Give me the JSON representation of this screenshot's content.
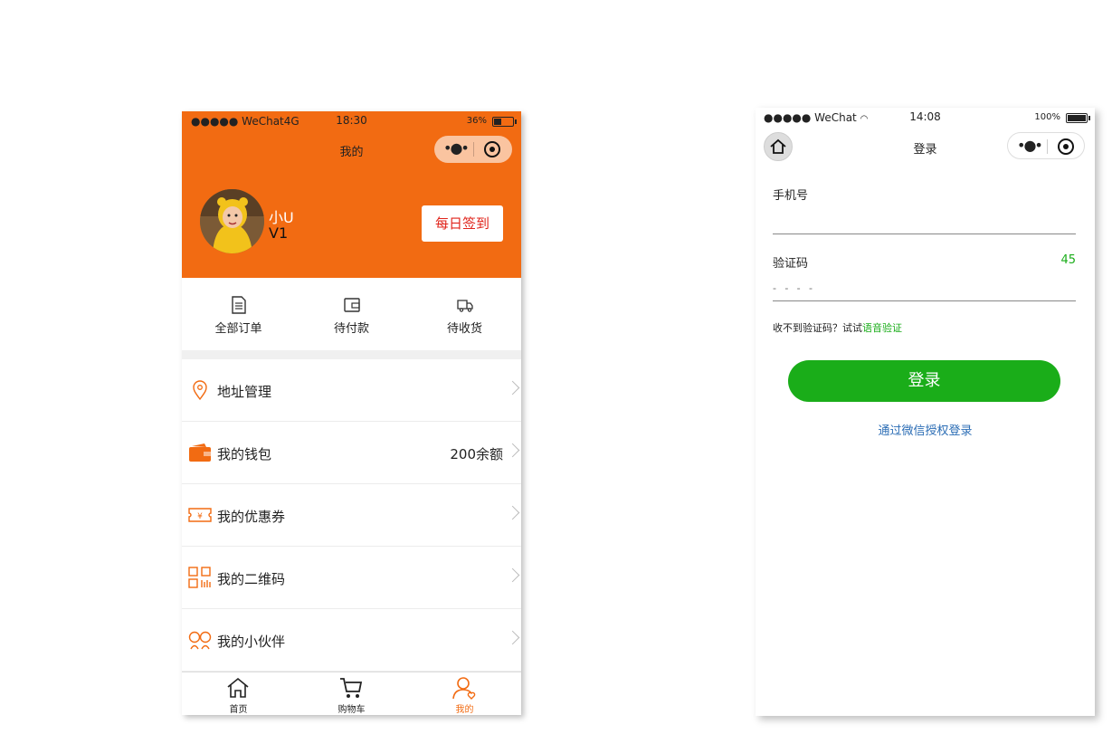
{
  "left_phone": {
    "status_bar": {
      "carrier": "●●●●● WeChat4G",
      "time": "18:30",
      "battery": "36%",
      "battery_level": 0.36
    },
    "nav": {
      "title": "我的"
    },
    "user": {
      "name": "小U",
      "level": "V1",
      "signin_label": "每日签到"
    },
    "orders": [
      {
        "label": "全部订单",
        "icon": "document-icon"
      },
      {
        "label": "待付款",
        "icon": "wallet-icon"
      },
      {
        "label": "待收货",
        "icon": "truck-icon"
      }
    ],
    "menu": [
      {
        "label": "地址管理",
        "value": "",
        "icon": "location-pin-icon"
      },
      {
        "label": "我的钱包",
        "value": "200余额",
        "icon": "wallet-icon"
      },
      {
        "label": "我的优惠券",
        "value": "",
        "icon": "coupon-icon"
      },
      {
        "label": "我的二维码",
        "value": "",
        "icon": "qrcode-icon"
      },
      {
        "label": "我的小伙伴",
        "value": "",
        "icon": "friends-icon"
      }
    ],
    "tabbar": [
      {
        "label": "首页",
        "icon": "home-icon"
      },
      {
        "label": "购物车",
        "icon": "cart-icon"
      },
      {
        "label": "我的",
        "icon": "user-icon"
      }
    ],
    "colors": {
      "accent": "#f26b12",
      "signin_text": "#e0241b"
    }
  },
  "right_phone": {
    "status_bar": {
      "carrier": "●●●●● WeChat",
      "time": "14:08",
      "battery": "100%",
      "battery_level": 1.0
    },
    "nav": {
      "title": "登录"
    },
    "form": {
      "phone_label": "手机号",
      "code_label": "验证码",
      "code_placeholder": "- - - -",
      "countdown": "45",
      "hint_prefix": "收不到验证码？试试",
      "hint_link": "语音验证",
      "login_label": "登录",
      "wechat_login": "通过微信授权登录"
    },
    "colors": {
      "primary": "#1aad19",
      "link": "#2b6db5"
    }
  }
}
